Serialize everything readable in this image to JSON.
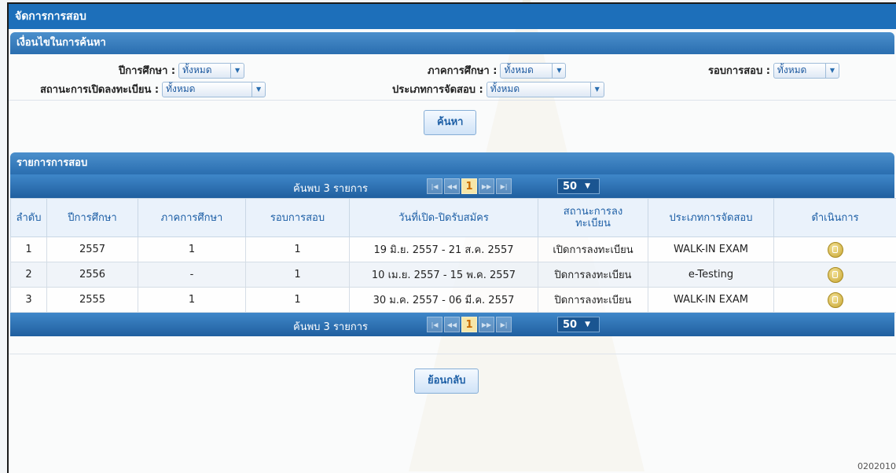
{
  "app": {
    "title": "จัดการการสอบ",
    "code": "0202010"
  },
  "search": {
    "header": "เงื่อนไขในการค้นหา",
    "fields": [
      {
        "label": "ปีการศึกษา :",
        "value": "ทั้งหมด"
      },
      {
        "label": "ภาคการศึกษา :",
        "value": "ทั้งหมด"
      },
      {
        "label": "รอบการสอบ :",
        "value": "ทั้งหมด"
      },
      {
        "label": "สถานะการเปิดลงทะเบียน :",
        "value": "ทั้งหมด"
      },
      {
        "label": "ประเภทการจัดสอบ :",
        "value": "ทั้งหมด"
      }
    ],
    "button": "ค้นหา"
  },
  "results": {
    "header": "รายการการสอบ",
    "found_text": "ค้นพบ 3 รายการ",
    "current_page": "1",
    "page_size": "50",
    "columns": [
      "ลำดับ",
      "ปีการศึกษา",
      "ภาคการศึกษา",
      "รอบการสอบ",
      "วันที่เปิด-ปิดรับสมัคร",
      "สถานะการลงทะเบียน",
      "ประเภทการจัดสอบ",
      "ดำเนินการ"
    ],
    "rows": [
      [
        "1",
        "2557",
        "1",
        "1",
        "19 มิ.ย. 2557 - 21 ส.ค. 2557",
        "เปิดการลงทะเบียน",
        "WALK-IN EXAM"
      ],
      [
        "2",
        "2556",
        "-",
        "1",
        "10 เม.ย. 2557 - 15 พ.ค. 2557",
        "ปิดการลงทะเบียน",
        "e-Testing"
      ],
      [
        "3",
        "2555",
        "1",
        "1",
        "30 ม.ค. 2557 - 06 มี.ค. 2557",
        "ปิดการลงทะเบียน",
        "WALK-IN EXAM"
      ]
    ],
    "action_icon": "edit-icon"
  },
  "back_button": "ย้อนกลับ",
  "colors": {
    "title_bar": "#1d6fba",
    "header_blue": "#2a6eb0",
    "page_highlight": "#c86a00"
  }
}
